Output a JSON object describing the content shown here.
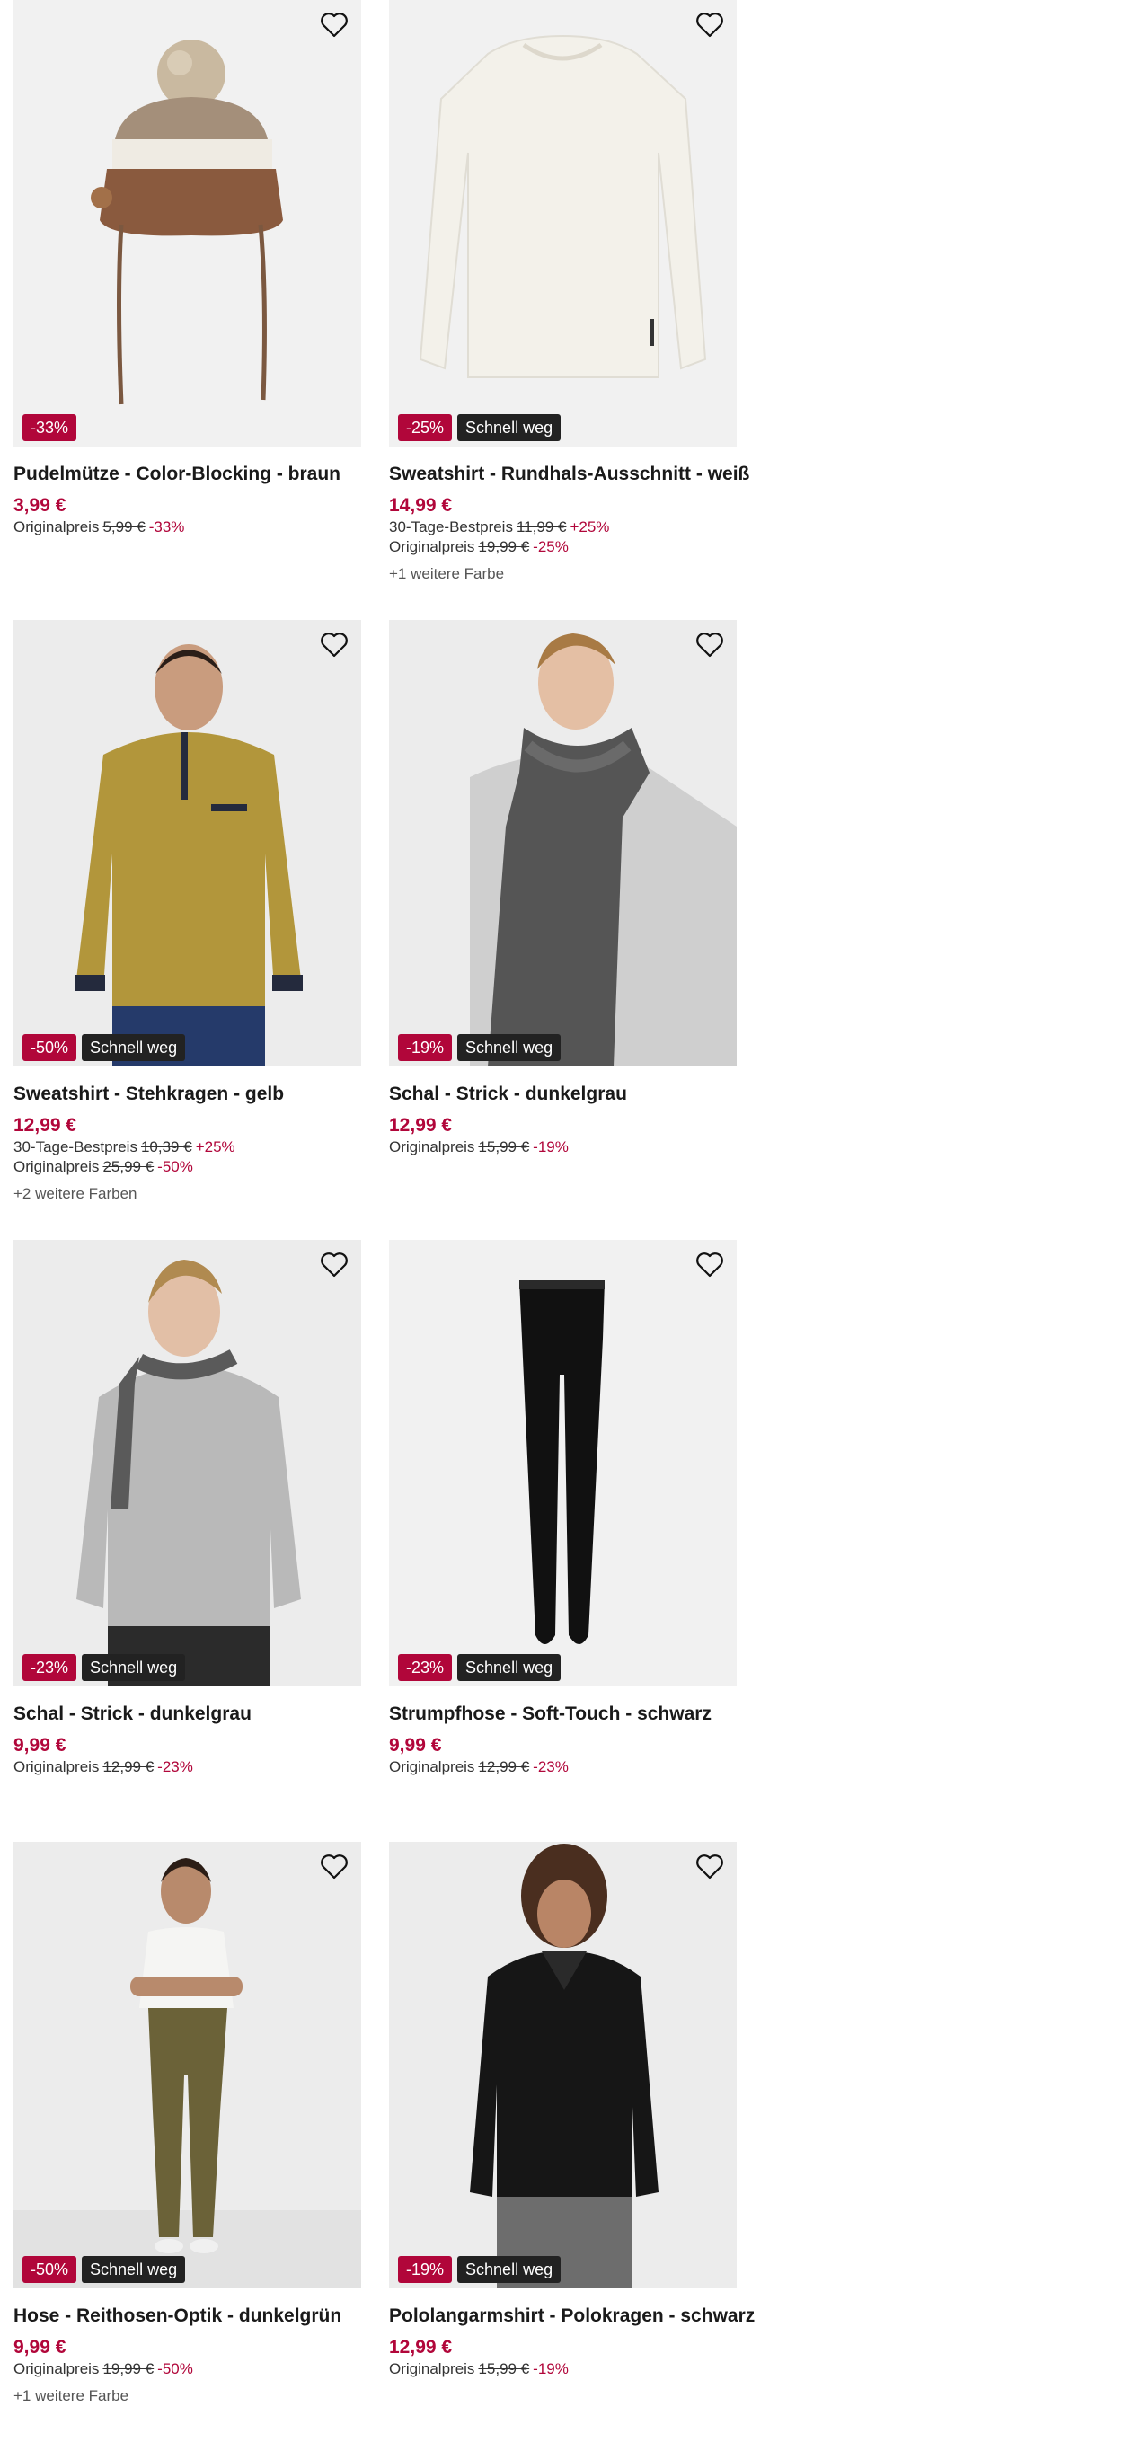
{
  "colors": {
    "sale": "#b1063a",
    "fast_badge": "#222222",
    "image_bg": "#f1f1f1"
  },
  "wishlist_icon": "heart-outline-icon",
  "products": [
    {
      "title": "Pudelmütze - Color-Blocking - braun",
      "price": "3,99 €",
      "discount_badge": "-33%",
      "fast_badge": "",
      "best_price": null,
      "original": {
        "label": "Originalpreis",
        "value": "5,99 €",
        "pct": "-33%"
      },
      "more_colors": ""
    },
    {
      "title": "Sweatshirt - Rundhals-Ausschnitt - weiß",
      "price": "14,99 €",
      "discount_badge": "-25%",
      "fast_badge": "Schnell weg",
      "best_price": {
        "label": "30-Tage-Bestpreis",
        "value": "11,99 €",
        "pct": "+25%"
      },
      "original": {
        "label": "Originalpreis",
        "value": "19,99 €",
        "pct": "-25%"
      },
      "more_colors": "+1 weitere Farbe"
    },
    {
      "title": "Sweatshirt - Stehkragen - gelb",
      "price": "12,99 €",
      "discount_badge": "-50%",
      "fast_badge": "Schnell weg",
      "best_price": {
        "label": "30-Tage-Bestpreis",
        "value": "10,39 €",
        "pct": "+25%"
      },
      "original": {
        "label": "Originalpreis",
        "value": "25,99 €",
        "pct": "-50%"
      },
      "more_colors": "+2 weitere Farben"
    },
    {
      "title": "Schal - Strick - dunkelgrau",
      "price": "12,99 €",
      "discount_badge": "-19%",
      "fast_badge": "Schnell weg",
      "best_price": null,
      "original": {
        "label": "Originalpreis",
        "value": "15,99 €",
        "pct": "-19%"
      },
      "more_colors": ""
    },
    {
      "title": "Schal - Strick - dunkelgrau",
      "price": "9,99 €",
      "discount_badge": "-23%",
      "fast_badge": "Schnell weg",
      "best_price": null,
      "original": {
        "label": "Originalpreis",
        "value": "12,99 €",
        "pct": "-23%"
      },
      "more_colors": ""
    },
    {
      "title": "Strumpfhose - Soft-Touch - schwarz",
      "price": "9,99 €",
      "discount_badge": "-23%",
      "fast_badge": "Schnell weg",
      "best_price": null,
      "original": {
        "label": "Originalpreis",
        "value": "12,99 €",
        "pct": "-23%"
      },
      "more_colors": ""
    },
    {
      "title": "Hose - Reithosen-Optik - dunkelgrün",
      "price": "9,99 €",
      "discount_badge": "-50%",
      "fast_badge": "Schnell weg",
      "best_price": null,
      "original": {
        "label": "Originalpreis",
        "value": "19,99 €",
        "pct": "-50%"
      },
      "more_colors": "+1 weitere Farbe"
    },
    {
      "title": "Pololangarmshirt - Polokragen - schwarz",
      "price": "12,99 €",
      "discount_badge": "-19%",
      "fast_badge": "Schnell weg",
      "best_price": null,
      "original": {
        "label": "Originalpreis",
        "value": "15,99 €",
        "pct": "-19%"
      },
      "more_colors": ""
    }
  ]
}
